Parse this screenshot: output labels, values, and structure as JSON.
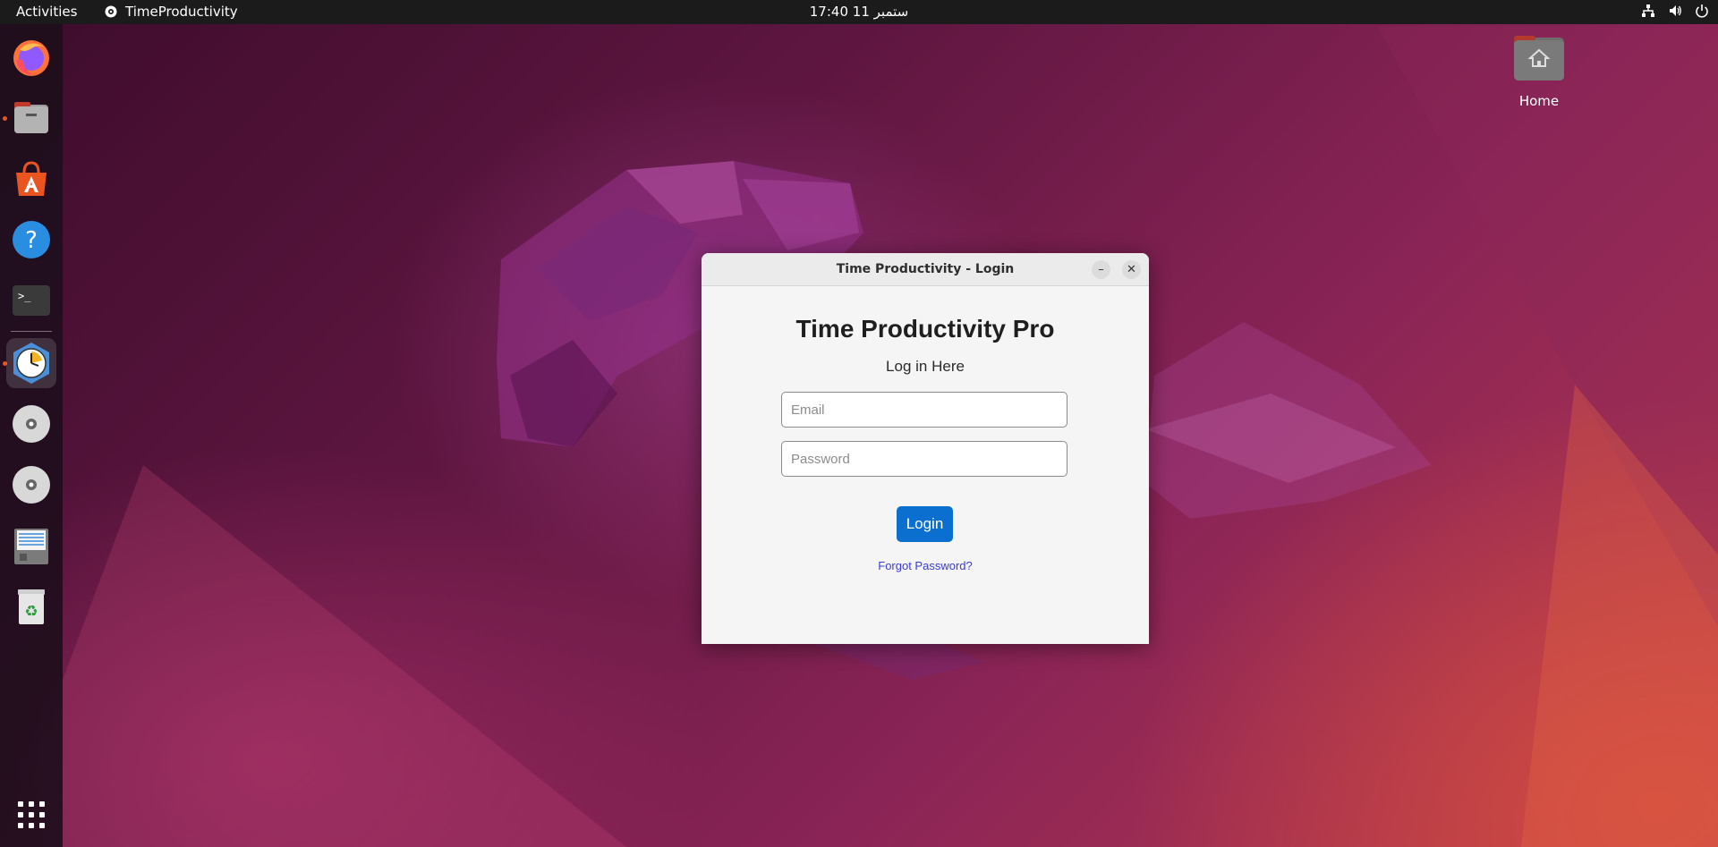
{
  "topbar": {
    "activities": "Activities",
    "app_name": "TimeProductivity",
    "clock": "ستمبر 11  17:40",
    "tray_icons": [
      "network-icon",
      "volume-icon",
      "power-icon"
    ]
  },
  "dock": {
    "items": [
      {
        "name": "firefox-icon",
        "running": false
      },
      {
        "name": "files-icon",
        "running": true
      },
      {
        "name": "app-center-icon",
        "running": false
      },
      {
        "name": "help-icon",
        "running": false
      },
      {
        "name": "terminal-icon",
        "running": false
      },
      {
        "name": "time-productivity-icon",
        "running": true,
        "active": true
      },
      {
        "name": "disc-icon",
        "running": false
      },
      {
        "name": "disc-icon",
        "running": false
      },
      {
        "name": "text-editor-icon",
        "running": false
      },
      {
        "name": "trash-icon",
        "running": false
      }
    ],
    "apps_grid_icon": "show-apps-icon"
  },
  "desktop": {
    "home_label": "Home"
  },
  "window": {
    "title": "Time Productivity - Login",
    "app_title": "Time Productivity Pro",
    "subtitle": "Log in Here",
    "email_placeholder": "Email",
    "password_placeholder": "Password",
    "email_value": "",
    "password_value": "",
    "login_label": "Login",
    "forgot_label": "Forgot Password?"
  },
  "colors": {
    "accent": "#0b6fd0",
    "link": "#3b3bd6",
    "ubuntu_orange": "#e95420"
  }
}
